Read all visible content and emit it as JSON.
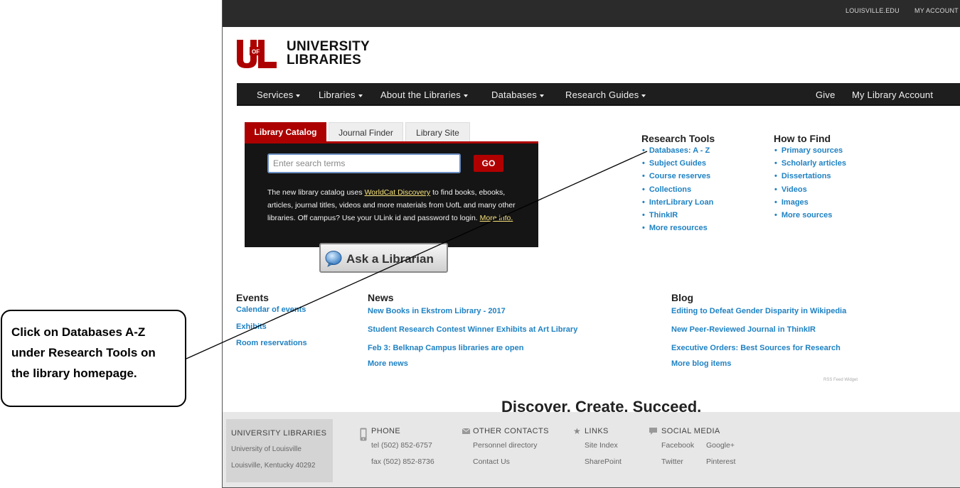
{
  "utility_bar": {
    "links": [
      "LOUISVILLE.EDU",
      "MY ACCOUNT"
    ]
  },
  "logo": {
    "mark_text": "UofL",
    "line1": "UNIVERSITY",
    "line2": "LIBRARIES"
  },
  "nav": {
    "left": [
      {
        "label": "Services",
        "dropdown": true
      },
      {
        "label": "Libraries",
        "dropdown": true
      },
      {
        "label": "About the Libraries",
        "dropdown": true
      },
      {
        "label": "Databases",
        "dropdown": true
      },
      {
        "label": "Research Guides",
        "dropdown": true
      }
    ],
    "right": [
      {
        "label": "Give"
      },
      {
        "label": "My Library Account"
      }
    ]
  },
  "search": {
    "tabs": [
      {
        "label": "Library Catalog",
        "active": true
      },
      {
        "label": "Journal Finder",
        "active": false
      },
      {
        "label": "Library Site",
        "active": false
      }
    ],
    "placeholder": "Enter search terms",
    "go_label": "GO",
    "desc_part1": "The new library catalog uses ",
    "desc_link": "WorldCat Discovery",
    "desc_part2": " to find books, ebooks, articles, journal titles, videos and more materials from UofL and many other libraries. Off campus? Use your ULink id and password to login. ",
    "desc_more": "More info."
  },
  "ask_librarian": {
    "label": "Ask a Librarian",
    "icon": "speech-bubble-icon"
  },
  "research_tools": {
    "title": "Research Tools",
    "items": [
      "Databases: A - Z",
      "Subject Guides",
      "Course reserves",
      "Collections",
      "InterLibrary Loan",
      "ThinkIR",
      "More resources"
    ]
  },
  "how_to_find": {
    "title": "How to Find",
    "items": [
      "Primary sources",
      "Scholarly articles",
      "Dissertations",
      "Videos",
      "Images",
      "More sources"
    ]
  },
  "events": {
    "title": "Events",
    "items": [
      "Calendar of events",
      "Exhibits",
      "Room reservations"
    ]
  },
  "news": {
    "title": "News",
    "items": [
      "New Books in Ekstrom Library - 2017",
      "Student Research Contest Winner Exhibits at Art Library",
      "Feb 3: Belknap Campus libraries are open",
      "More news"
    ]
  },
  "blog": {
    "title": "Blog",
    "items": [
      "Editing to Defeat Gender Disparity in Wikipedia",
      "New Peer-Reviewed Journal in ThinkIR",
      "Executive Orders: Best Sources for Research",
      "More blog items"
    ],
    "widget_credit": "RSS Feed Widget"
  },
  "tagline": "Discover. Create. Succeed.",
  "footer": {
    "library": {
      "title": "UNIVERSITY LIBRARIES",
      "line1": "University of Louisville",
      "line2": "Louisville, Kentucky 40292"
    },
    "phone": {
      "title": "PHONE",
      "tel": "tel (502) 852-6757",
      "fax": "fax (502) 852-8736"
    },
    "other_contacts": {
      "title": "OTHER CONTACTS",
      "items": [
        "Personnel directory",
        "Contact Us"
      ]
    },
    "links": {
      "title": "LINKS",
      "items": [
        "Site Index",
        "SharePoint"
      ]
    },
    "social": {
      "title": "SOCIAL MEDIA",
      "items": [
        "Facebook",
        "Google+",
        "Twitter",
        "Pinterest"
      ]
    }
  },
  "callout": {
    "text": "Click on Databases A-Z under Research Tools on the library homepage."
  },
  "colors": {
    "brand_red": "#ad0000",
    "link_blue": "#1f82c3",
    "nav_dark": "#1e1e1e"
  }
}
